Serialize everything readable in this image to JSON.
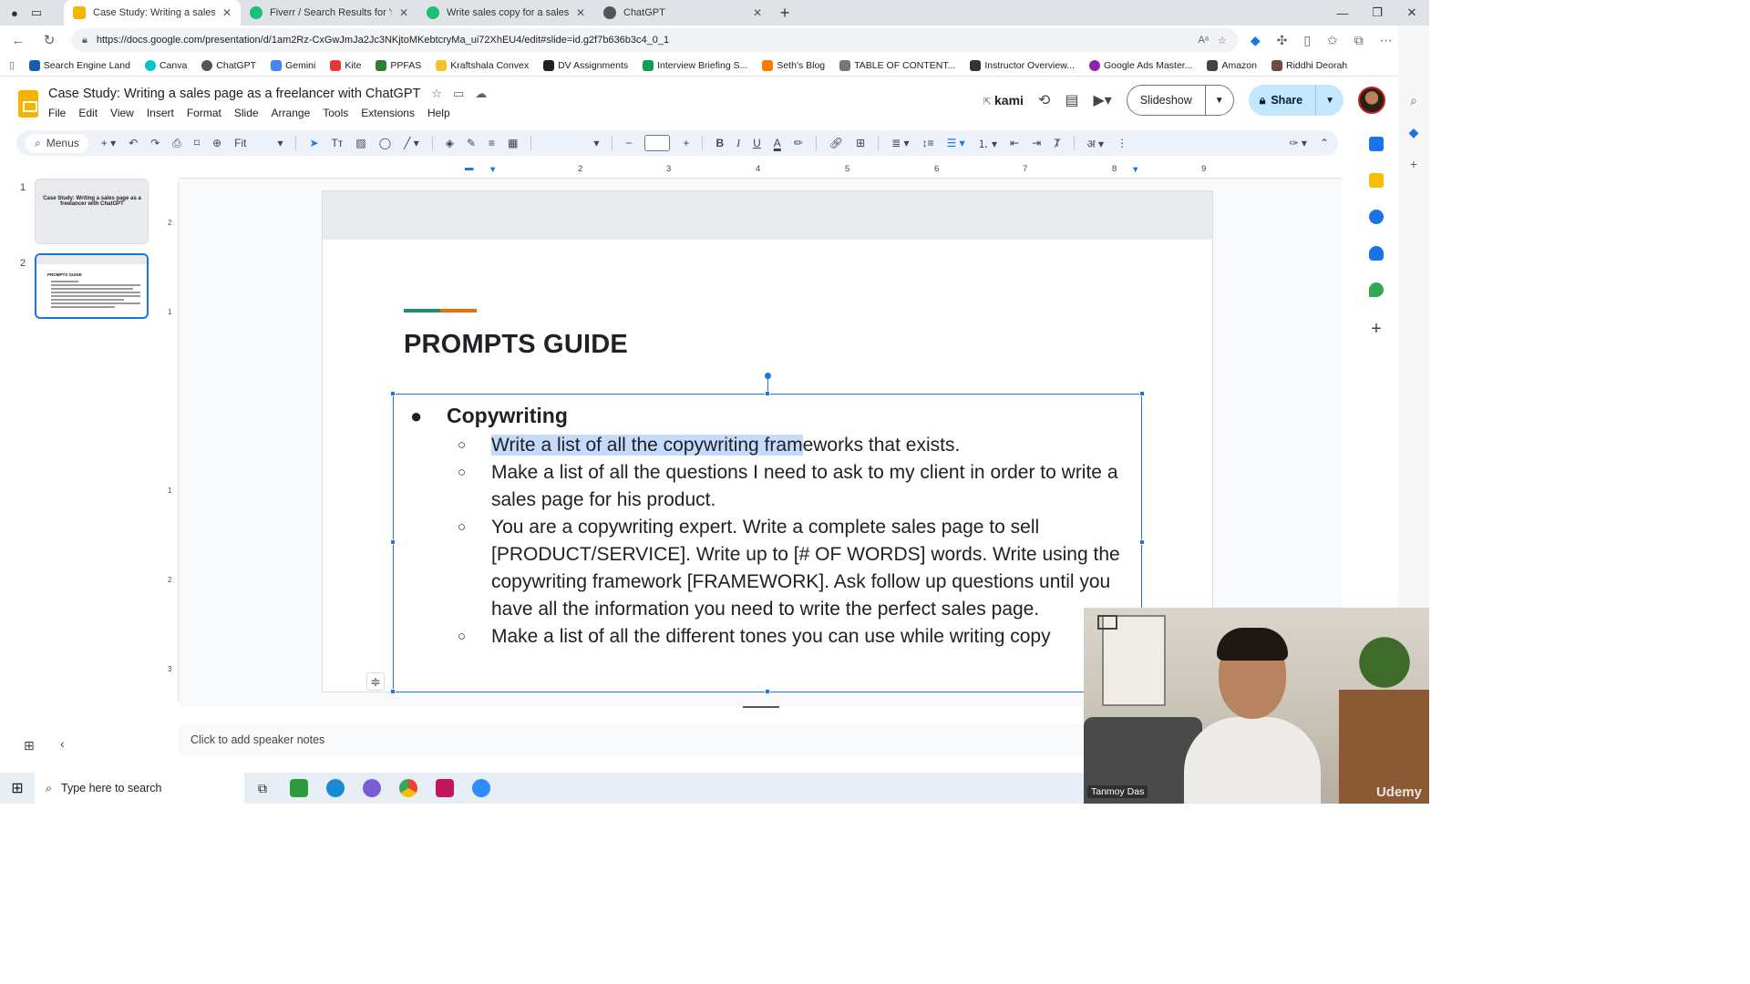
{
  "browser": {
    "tabs": [
      {
        "title": "Case Study: Writing a sales page",
        "color": "#f4b400",
        "active": true
      },
      {
        "title": "Fiverr / Search Results for 'sales p",
        "color": "#1dbf73",
        "active": false
      },
      {
        "title": "Write sales copy for a sales page",
        "color": "#1dbf73",
        "active": false
      },
      {
        "title": "ChatGPT",
        "color": "#555555",
        "active": false
      }
    ],
    "url": "https://docs.google.com/presentation/d/1am2Rz-CxGwJmJa2Jc3NKjtoMKebtcryMa_ui72XhEU4/edit#slide=id.g2f7b636b3c4_0_1",
    "bookmarks": [
      {
        "label": "Search Engine Land",
        "color": "#1b5fa8"
      },
      {
        "label": "Canva",
        "color": "#00c4cc"
      },
      {
        "label": "ChatGPT",
        "color": "#555555"
      },
      {
        "label": "Gemini",
        "color": "#4285f4"
      },
      {
        "label": "Kite",
        "color": "#e53935"
      },
      {
        "label": "PPFAS",
        "color": "#2e7d32"
      },
      {
        "label": "Kraftshala Convex",
        "color": "#fbc02d"
      },
      {
        "label": "DV Assignments",
        "color": "#222222"
      },
      {
        "label": "Interview Briefing S...",
        "color": "#0f9d58"
      },
      {
        "label": "Seth's Blog",
        "color": "#f57c00"
      },
      {
        "label": "TABLE OF CONTENT...",
        "color": "#777777"
      },
      {
        "label": "Instructor Overview...",
        "color": "#333333"
      },
      {
        "label": "Google Ads Master...",
        "color": "#8e24aa"
      },
      {
        "label": "Amazon",
        "color": "#444444"
      },
      {
        "label": "Riddhi Deorah",
        "color": "#6d4c41"
      }
    ]
  },
  "docs": {
    "title": "Case Study: Writing a sales page as a freelancer with ChatGPT",
    "menu": [
      "File",
      "Edit",
      "View",
      "Insert",
      "Format",
      "Slide",
      "Arrange",
      "Tools",
      "Extensions",
      "Help"
    ],
    "kami": "kami",
    "slideshow": "Slideshow",
    "share": "Share"
  },
  "toolbar": {
    "menus": "Menus",
    "zoom": "Fit",
    "bold": "B",
    "italic": "I",
    "underline": "U"
  },
  "ruler": [
    "1",
    "2",
    "3",
    "4",
    "5",
    "6",
    "7",
    "8",
    "9"
  ],
  "filmstrip": {
    "slides": [
      {
        "num": "1",
        "text": "Case Study: Writing a sales page as a freelancer with ChatGPT"
      },
      {
        "num": "2",
        "text": "PROMPTS GUIDE"
      }
    ]
  },
  "slide": {
    "heading": "PROMPTS GUIDE",
    "bullet": "Copywriting",
    "item1_highlighted": "Write a list of all the copywriting fram",
    "item1_rest": "eworks that exists.",
    "items": [
      "Make a list of all the questions I need to ask to my client in order to write a sales page for his product.",
      "You are a copywriting expert. Write a complete sales page to sell [PRODUCT/SERVICE]. Write up to [# OF WORDS] words. Write using the copywriting framework [FRAMEWORK]. Ask follow up questions until you have all the information you need to write the perfect sales page.",
      "Make a list of all the different tones you can use while writing copy"
    ]
  },
  "notes": "Click to add speaker notes",
  "webcam": {
    "name": "Tanmoy Das",
    "watermark": "Udemy"
  },
  "taskbar": {
    "search_placeholder": "Type here to search"
  }
}
